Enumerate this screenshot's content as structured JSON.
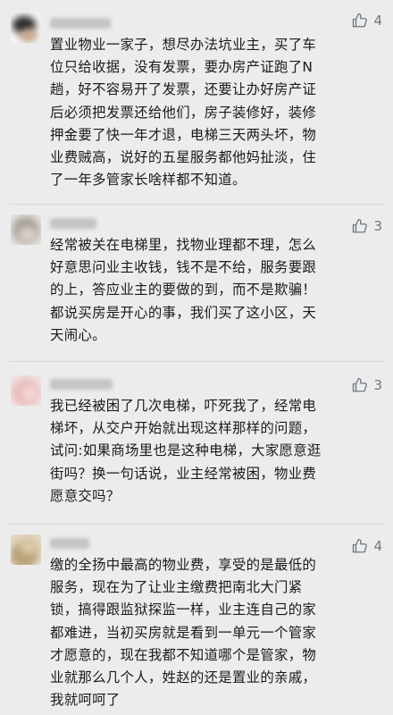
{
  "comments": [
    {
      "username": "",
      "likes": "4",
      "text": "置业物业一家子，想尽办法坑业主，买了车\n位只给收据，没有发票，要办房产证跑了N\n趟，好不容易开了发票，还要让办好房产证\n后必须把发票还给他们，房子装修好，装修\n押金要了快一年才退，电梯三天两头坏，物\n业费贼高，说好的五星服务都他妈扯淡，住\n了一年多管家长啥样都不知道。",
      "avatar_color": "#2b2b2b"
    },
    {
      "username": "",
      "likes": "3",
      "text": "经常被关在电梯里，找物业理都不理，怎么\n好意思问业主收钱，钱不是不给，服务要跟\n的上，答应业主的要做的到，而不是欺骗！\n都说买房是开心的事，我们买了这小区，天\n天闹心。",
      "avatar_color": "#a7a09a"
    },
    {
      "username": "",
      "likes": "3",
      "text": "我已经被困了几次电梯，吓死我了，经常电\n梯坏，从交户开始就出现这样那样的问题，\n试问:如果商场里也是这种电梯，大家愿意逛\n街吗？换一句话说，业主经常被困，物业费\n愿意交吗？",
      "avatar_color": "#e8b9b9"
    },
    {
      "username": "",
      "likes": "4",
      "text": "缴的全扬中最高的物业费，享受的是最低的\n服务，现在为了让业主缴费把南北大门紧\n锁，搞得跟监狱探监一样，业主连自己的家\n都难进，当初买房就是看到一单元一个管家\n才愿意的，现在我都不知道哪个是管家，物\n业就那么几个人，姓赵的还是置业的亲戚，\n我就呵呵了",
      "avatar_color": "#b9a27a"
    }
  ]
}
